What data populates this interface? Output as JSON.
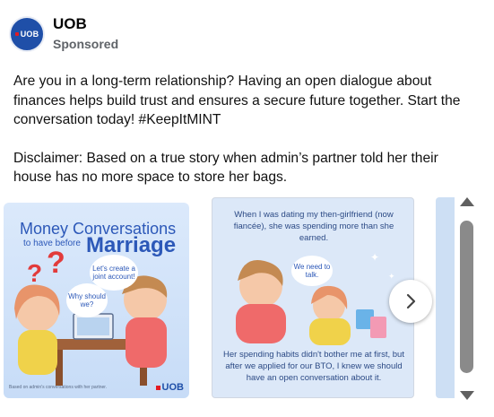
{
  "post": {
    "page_name": "UOB",
    "sponsored": "Sponsored",
    "avatar_text": "UOB",
    "caption_1": "Are you in a long-term relationship? Having an open dialogue about finances helps build trust and ensures a secure future together. Start the conversation today! #KeepItMINT",
    "caption_2": "Disclaimer: Based on a true story when admin’s partner told her their house has no more space to store her bags."
  },
  "carousel": {
    "card1": {
      "title_1": "Money Conversations",
      "subtitle": "to have before",
      "title_2": "Marriage",
      "bubble_left": "Why should we?",
      "bubble_right": "Let's create a joint account!",
      "footnote": "Based on admin's conversations with her partner.",
      "logo": "UOB"
    },
    "card2": {
      "top_text": "When I was dating my then-girlfriend (now fiancée), she was spending more than she earned.",
      "bubble": "We need to talk.",
      "bottom_text": "Her spending habits didn't bother me at first, but after we applied for our BTO, I knew we should have an open conversation about it."
    },
    "next_icon": "chevron-right-icon"
  },
  "colors": {
    "brand": "#1f4fa8",
    "accent_red": "#e31b23",
    "card_bg": "#dce8f8",
    "title_blue": "#2c58b8"
  }
}
